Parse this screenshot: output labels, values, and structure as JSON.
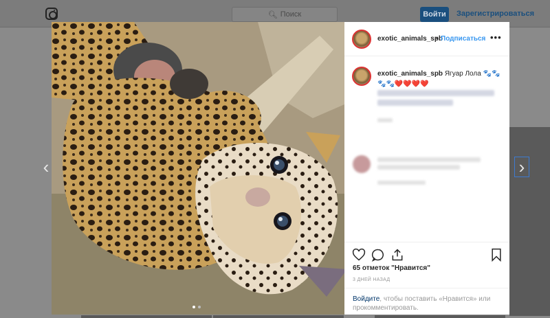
{
  "header": {
    "search_placeholder": "Поиск",
    "login_label": "Войти",
    "signup_label": "Зарегистрироваться"
  },
  "post": {
    "username": "exotic_animals_spb",
    "separator": "•",
    "follow_label": "Подписаться",
    "more_label": "•••",
    "caption_user": "exotic_animals_spb",
    "caption_text": "Ягуар Лола 🐾🐾",
    "caption_emojis": "🐾🐾❤️❤️❤️❤️",
    "likes": "65 отметок \"Нравится\"",
    "time": "3 ДНЕЙ НАЗАД",
    "login_link": "Войдите",
    "login_text": ", чтобы поставить «Нравится» или прокомментировать."
  },
  "icons": {
    "like": "heart-icon",
    "comment": "comment-icon",
    "share": "share-icon",
    "save": "bookmark-icon"
  },
  "colors": {
    "accent": "#3897f0",
    "link": "#003569",
    "heart": "#ed4956"
  }
}
